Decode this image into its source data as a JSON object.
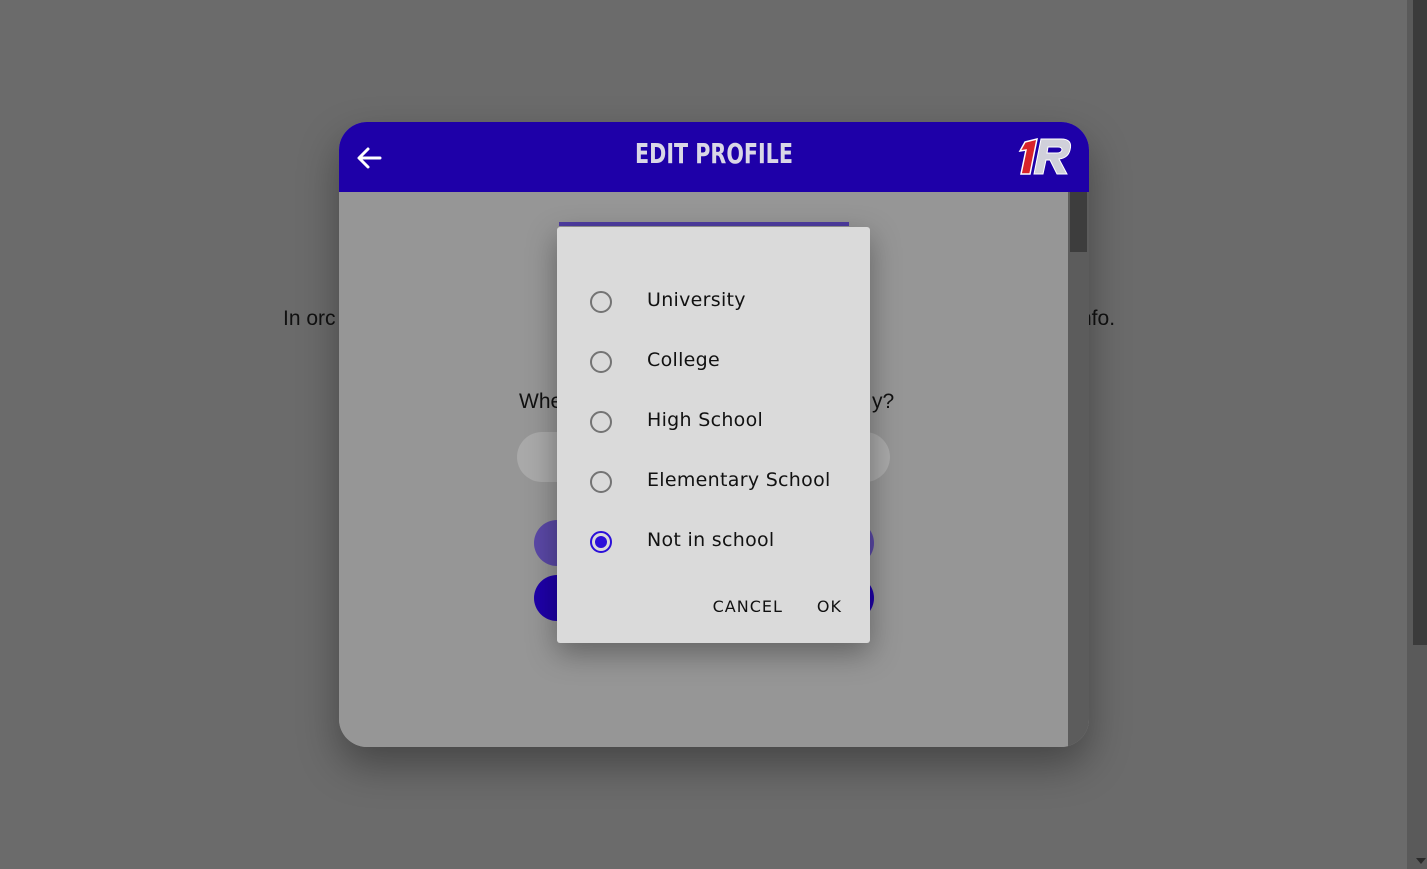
{
  "background": {
    "intro_left": "In orc",
    "intro_right": "nfo."
  },
  "header": {
    "title": "EDIT PROFILE",
    "back_icon": "arrow-left-icon",
    "logo_text": "1R"
  },
  "form": {
    "question_left": "Whe",
    "question_right": "y?"
  },
  "dialog": {
    "options": [
      {
        "label": "University",
        "selected": false
      },
      {
        "label": "College",
        "selected": false
      },
      {
        "label": "High School",
        "selected": false
      },
      {
        "label": "Elementary School",
        "selected": false
      },
      {
        "label": "Not in school",
        "selected": true
      }
    ],
    "cancel_label": "CANCEL",
    "ok_label": "OK"
  },
  "colors": {
    "header": "#1e00a8",
    "accent": "#2b0fd9",
    "logo_red": "#d8232a"
  }
}
